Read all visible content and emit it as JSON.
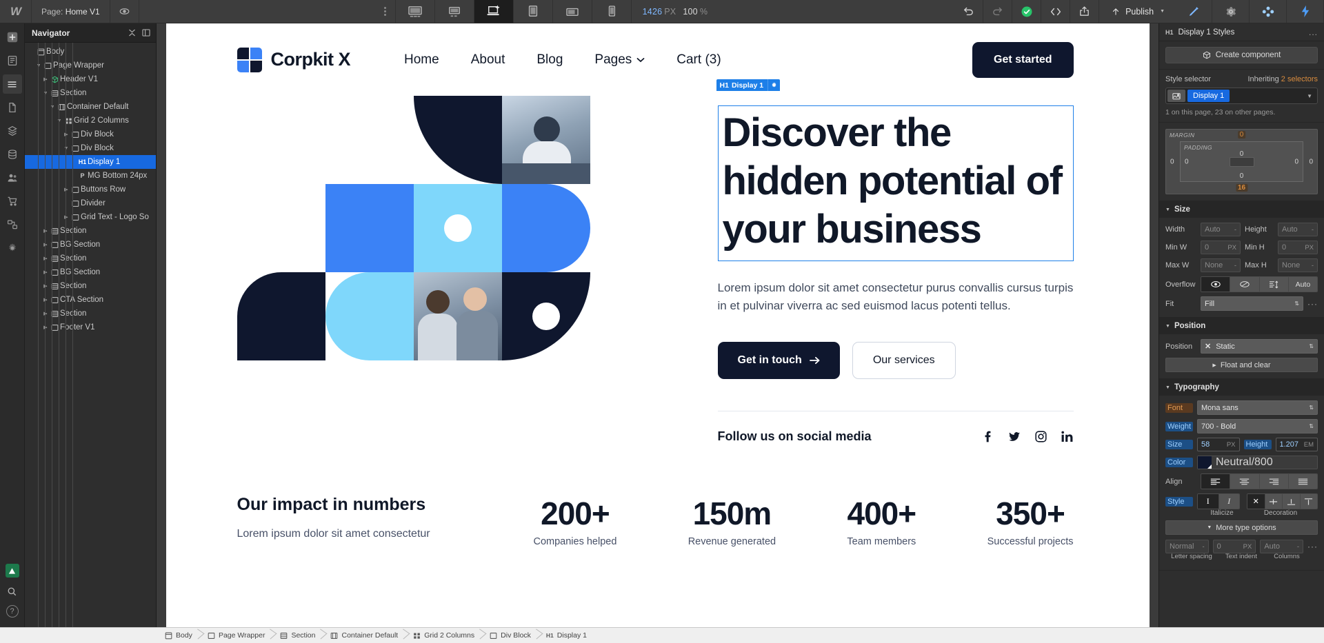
{
  "topbar": {
    "logo": "webflow-logo",
    "page_label": "Page:",
    "page_name": "Home V1",
    "preview_icon": "eye-icon",
    "devices": [
      {
        "name": "desktop-large",
        "active": false
      },
      {
        "name": "desktop-medium",
        "active": false
      },
      {
        "name": "desktop-base",
        "active": true
      },
      {
        "name": "tablet",
        "active": false
      },
      {
        "name": "mobile-landscape",
        "active": false
      },
      {
        "name": "mobile-portrait",
        "active": false
      }
    ],
    "canvas_width": "1426",
    "canvas_width_unit": "PX",
    "zoom": "100",
    "zoom_unit": "%",
    "undo": "undo-icon",
    "redo": "redo-icon",
    "status": "check-circle-icon",
    "code": "code-icon",
    "share": "share-icon",
    "publish_label": "Publish"
  },
  "rail": {
    "items": [
      {
        "name": "add-element",
        "icon": "plus-icon"
      },
      {
        "name": "pages",
        "icon": "pages-icon"
      },
      {
        "name": "navigator",
        "icon": "layers-icon",
        "selected": true
      },
      {
        "name": "assets",
        "icon": "file-icon"
      },
      {
        "name": "components",
        "icon": "stack-icon"
      },
      {
        "name": "cms",
        "icon": "database-icon"
      },
      {
        "name": "users",
        "icon": "users-icon"
      },
      {
        "name": "ecommerce",
        "icon": "cart-icon"
      },
      {
        "name": "logic",
        "icon": "logic-icon"
      },
      {
        "name": "settings",
        "icon": "gear-icon"
      }
    ],
    "bottom": [
      {
        "name": "publish-status",
        "icon": "triangle-icon"
      },
      {
        "name": "search",
        "icon": "search-icon"
      },
      {
        "name": "help",
        "icon": "question-icon"
      }
    ]
  },
  "navigator": {
    "title": "Navigator",
    "collapse_icon": "collapse-icon",
    "panel_icon": "panel-icon",
    "tree": [
      {
        "label": "Body",
        "indent": 0,
        "icon": "body",
        "caret": "none",
        "selected": false
      },
      {
        "label": "Page Wrapper",
        "indent": 1,
        "icon": "div",
        "caret": "open",
        "selected": false
      },
      {
        "label": "Header V1",
        "indent": 2,
        "icon": "component",
        "caret": "closed",
        "selected": false
      },
      {
        "label": "Section",
        "indent": 2,
        "icon": "section",
        "caret": "open",
        "selected": false
      },
      {
        "label": "Container Default",
        "indent": 3,
        "icon": "container",
        "caret": "open",
        "selected": false
      },
      {
        "label": "Grid 2 Columns",
        "indent": 4,
        "icon": "grid",
        "caret": "open",
        "selected": false
      },
      {
        "label": "Div Block",
        "indent": 5,
        "icon": "div",
        "caret": "closed",
        "selected": false
      },
      {
        "label": "Div Block",
        "indent": 5,
        "icon": "div",
        "caret": "open",
        "selected": false
      },
      {
        "label": "Display 1",
        "indent": 6,
        "icon": "h1",
        "caret": "none",
        "selected": true
      },
      {
        "label": "MG Bottom 24px",
        "indent": 6,
        "icon": "p",
        "caret": "none",
        "selected": false
      },
      {
        "label": "Buttons Row",
        "indent": 5,
        "icon": "div",
        "caret": "closed",
        "selected": false
      },
      {
        "label": "Divider",
        "indent": 5,
        "icon": "div",
        "caret": "none",
        "selected": false
      },
      {
        "label": "Grid Text - Logo So",
        "indent": 5,
        "icon": "div",
        "caret": "closed",
        "selected": false
      },
      {
        "label": "Section",
        "indent": 2,
        "icon": "section",
        "caret": "closed",
        "selected": false
      },
      {
        "label": "BG Section",
        "indent": 2,
        "icon": "div",
        "caret": "closed",
        "selected": false
      },
      {
        "label": "Section",
        "indent": 2,
        "icon": "section",
        "caret": "closed",
        "selected": false
      },
      {
        "label": "BG Section",
        "indent": 2,
        "icon": "div",
        "caret": "closed",
        "selected": false
      },
      {
        "label": "Section",
        "indent": 2,
        "icon": "section",
        "caret": "closed",
        "selected": false
      },
      {
        "label": "CTA Section",
        "indent": 2,
        "icon": "div",
        "caret": "closed",
        "selected": false
      },
      {
        "label": "Section",
        "indent": 2,
        "icon": "section",
        "caret": "closed",
        "selected": false
      },
      {
        "label": "Footer V1",
        "indent": 2,
        "icon": "div",
        "caret": "closed",
        "selected": false
      }
    ]
  },
  "canvas": {
    "site": {
      "brand": "Corpkit X",
      "nav": [
        {
          "label": "Home",
          "caret": false
        },
        {
          "label": "About",
          "caret": false
        },
        {
          "label": "Blog",
          "caret": false
        },
        {
          "label": "Pages",
          "caret": true
        },
        {
          "label": "Cart (3)",
          "caret": false
        }
      ],
      "header_cta": "Get started",
      "selection_badge": {
        "tag": "H1",
        "label": "Display 1",
        "gear": "gear-icon"
      },
      "hero_heading": "Discover the hidden potential of your business",
      "hero_sub": "Lorem ipsum dolor sit amet consectetur purus convallis cursus turpis in et pulvinar viverra ac sed euismod lacus potenti tellus.",
      "hero_btn_primary": "Get in touch",
      "hero_btn_secondary": "Our services",
      "social_label": "Follow us on social media",
      "social_icons": [
        "facebook-icon",
        "twitter-icon",
        "instagram-icon",
        "linkedin-icon"
      ],
      "impact_title": "Our impact in numbers",
      "impact_sub": "Lorem ipsum dolor sit amet consectetur",
      "stats": [
        {
          "value": "200+",
          "caption": "Companies helped"
        },
        {
          "value": "150m",
          "caption": "Revenue generated"
        },
        {
          "value": "400+",
          "caption": "Team members"
        },
        {
          "value": "350+",
          "caption": "Successful projects"
        }
      ]
    }
  },
  "styles": {
    "header": {
      "tag": "H1",
      "title": "Display 1 Styles",
      "more": "..."
    },
    "create_component": "Create component",
    "selector_label": "Style selector",
    "inheriting_prefix": "Inheriting",
    "inheriting_count": "2 selectors",
    "selector_chip": "Display 1",
    "selector_note": "1 on this page, 23 on other pages.",
    "spacing": {
      "margin_label": "MARGIN",
      "padding_label": "PADDING",
      "margin_top": "0",
      "margin_right": "0",
      "margin_bottom": "16",
      "margin_left": "0",
      "padding_top": "0",
      "padding_right": "0",
      "padding_bottom": "0",
      "padding_left": "0"
    },
    "size": {
      "title": "Size",
      "width_label": "Width",
      "width_value": "Auto",
      "height_label": "Height",
      "height_value": "Auto",
      "minw_label": "Min W",
      "minw_value": "0",
      "minw_unit": "PX",
      "minh_label": "Min H",
      "minh_value": "0",
      "minh_unit": "PX",
      "maxw_label": "Max W",
      "maxw_value": "None",
      "maxh_label": "Max H",
      "maxh_value": "None",
      "overflow_label": "Overflow",
      "overflow_options": [
        "visible-icon",
        "hidden-icon",
        "scroll-icon",
        "Auto"
      ],
      "overflow_selected": 0,
      "fit_label": "Fit",
      "fit_value": "Fill"
    },
    "position": {
      "title": "Position",
      "label": "Position",
      "value": "Static",
      "clear_icon": "x-icon",
      "float_and_clear": "Float and clear"
    },
    "typography": {
      "title": "Typography",
      "font_label": "Font",
      "font_value": "Mona sans",
      "weight_label": "Weight",
      "weight_value": "700 - Bold",
      "size_label": "Size",
      "size_value": "58",
      "size_unit": "PX",
      "height_label": "Height",
      "height_value": "1.207",
      "height_unit": "EM",
      "color_label": "Color",
      "color_value": "Neutral/800",
      "color_hex": "#0f172e",
      "align_label": "Align",
      "align_options": [
        "align-left-icon",
        "align-center-icon",
        "align-right-icon",
        "align-justify-icon"
      ],
      "align_selected": 0,
      "style_label": "Style",
      "style_options": [
        "upright-icon",
        "italic-icon"
      ],
      "style_selected": 0,
      "decoration_options": [
        "none-icon",
        "strikethrough-icon",
        "underline-icon",
        "overline-icon"
      ],
      "decoration_selected": 0,
      "italicize_caption": "Italicize",
      "decoration_caption": "Decoration",
      "more_type_options": "More type options",
      "letter_spacing_value": "Normal",
      "letter_spacing_caption": "Letter spacing",
      "text_indent_value": "0",
      "text_indent_unit": "PX",
      "text_indent_caption": "Text indent",
      "columns_value": "Auto",
      "columns_caption": "Columns"
    }
  },
  "breadcrumb": [
    {
      "label": "Body",
      "icon": "body"
    },
    {
      "label": "Page Wrapper",
      "icon": "div"
    },
    {
      "label": "Section",
      "icon": "section"
    },
    {
      "label": "Container Default",
      "icon": "container"
    },
    {
      "label": "Grid 2 Columns",
      "icon": "grid"
    },
    {
      "label": "Div Block",
      "icon": "div"
    },
    {
      "label": "Display 1",
      "icon": "h1"
    }
  ]
}
